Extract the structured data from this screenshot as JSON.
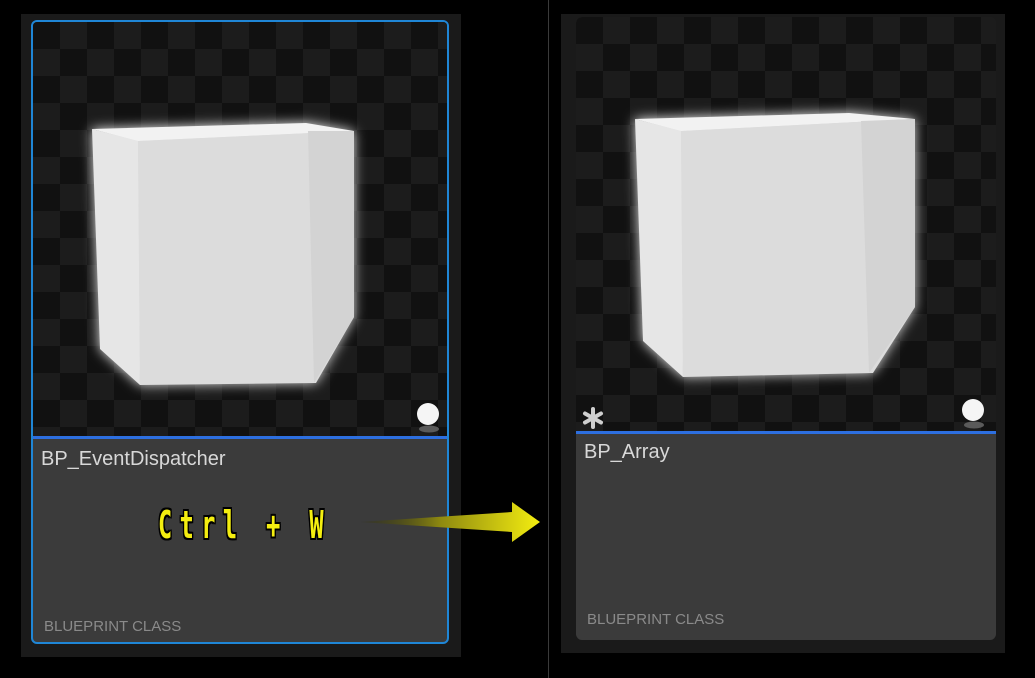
{
  "left_tile": {
    "name": "BP_EventDispatcher",
    "type": "BLUEPRINT CLASS",
    "selected": true,
    "thumbnail_icon": "cube-icon",
    "badge_icon": "sphere-icon"
  },
  "right_tile": {
    "name": "BP_Array",
    "type": "BLUEPRINT CLASS",
    "selected": false,
    "thumbnail_icon": "cube-icon",
    "badge_icon": "sphere-icon",
    "dirty_icon": "asterisk-icon"
  },
  "annotation": {
    "shortcut": "Ctrl + W",
    "arrow_icon": "arrow-right-icon",
    "color": "#f4ee10"
  },
  "colors": {
    "selection_border": "#1f86d6",
    "separator": "#2d6fe0",
    "tile_bg": "#3b3b3b"
  }
}
